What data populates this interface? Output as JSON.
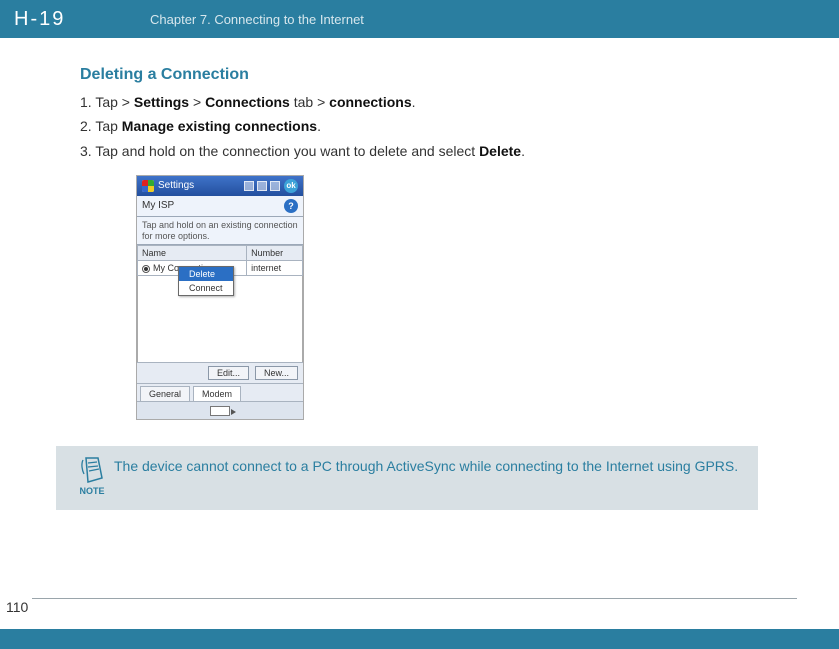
{
  "logo_text": "H-19",
  "header": {
    "chapter_title": "Chapter 7. Connecting to the Internet"
  },
  "section": {
    "heading": "Deleting a Connection",
    "steps": [
      {
        "num": "1.",
        "pre": "Tap  > ",
        "b1": "Settings",
        "mid1": " > ",
        "b2": "Connections",
        "mid2": " tab > ",
        "b3": "connections",
        "tail": "."
      },
      {
        "num": "2.",
        "pre": "Tap ",
        "b1": "Manage existing connections",
        "tail": "."
      },
      {
        "num": "3.",
        "pre": "Tap and hold on the connection you want to delete and select ",
        "b1": "Delete",
        "tail": "."
      }
    ]
  },
  "screenshot": {
    "titlebar_text": "Settings",
    "time_text": "",
    "subbar_label": "My ISP",
    "hint_text": "Tap and hold on an existing connection for more options.",
    "col_name": "Name",
    "col_number": "Number",
    "row_name": "My Connection",
    "row_number": "internet",
    "ctx_delete": "Delete",
    "ctx_connect": "Connect",
    "btn_edit": "Edit...",
    "btn_new": "New...",
    "tab_general": "General",
    "tab_modem": "Modem"
  },
  "note": {
    "label": "NOTE",
    "text": "The device cannot connect to a PC through ActiveSync while connecting to the Internet using GPRS."
  },
  "page_number": "110"
}
